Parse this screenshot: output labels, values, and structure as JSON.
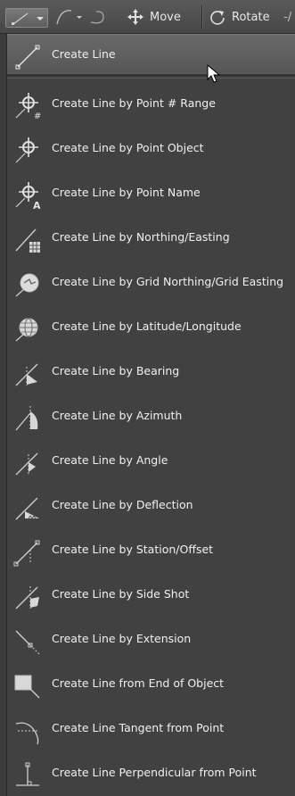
{
  "toolbar": {
    "move_label": "Move",
    "rotate_label": "Rotate",
    "trailing_label": "-/"
  },
  "menu": {
    "items": [
      {
        "label": "Create Line",
        "icon": "line-icon"
      },
      {
        "label": "Create Line by Point # Range",
        "icon": "point-range-icon"
      },
      {
        "label": "Create Line by Point Object",
        "icon": "point-object-icon"
      },
      {
        "label": "Create Line by Point Name",
        "icon": "point-name-icon"
      },
      {
        "label": "Create Line by Northing/Easting",
        "icon": "northing-easting-icon"
      },
      {
        "label": "Create Line by Grid Northing/Grid Easting",
        "icon": "grid-northing-icon"
      },
      {
        "label": "Create Line by Latitude/Longitude",
        "icon": "globe-icon"
      },
      {
        "label": "Create Line by Bearing",
        "icon": "bearing-icon"
      },
      {
        "label": "Create Line by Azimuth",
        "icon": "azimuth-icon"
      },
      {
        "label": "Create Line by Angle",
        "icon": "angle-icon"
      },
      {
        "label": "Create Line by Deflection",
        "icon": "deflection-icon"
      },
      {
        "label": "Create Line by Station/Offset",
        "icon": "station-offset-icon"
      },
      {
        "label": "Create Line by Side Shot",
        "icon": "side-shot-icon"
      },
      {
        "label": "Create Line by Extension",
        "icon": "extension-icon"
      },
      {
        "label": "Create Line from End of Object",
        "icon": "end-of-object-icon"
      },
      {
        "label": "Create Line Tangent from Point",
        "icon": "tangent-icon"
      },
      {
        "label": "Create Line Perpendicular from Point",
        "icon": "perpendicular-icon"
      }
    ]
  }
}
